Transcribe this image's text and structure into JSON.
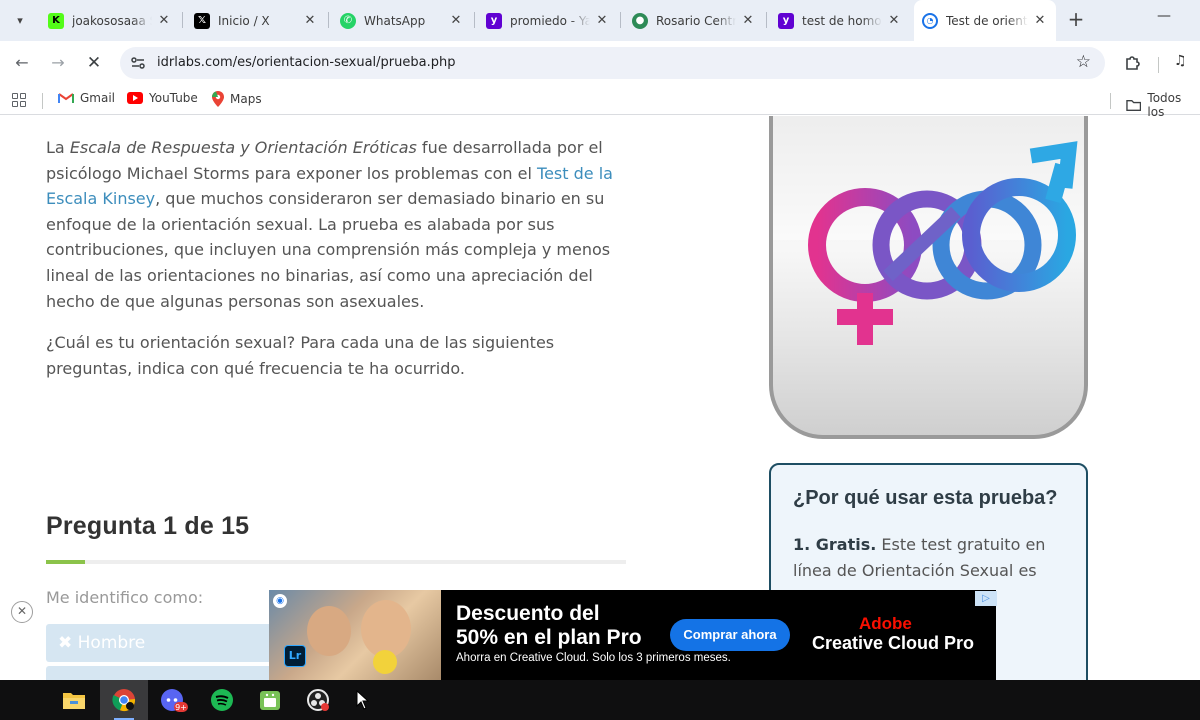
{
  "tabs": [
    {
      "title": "joakososaaa S",
      "favicon": "kick-icon",
      "color": "#53fc18",
      "active": false
    },
    {
      "title": "Inicio / X",
      "favicon": "x-icon",
      "color": "#000000",
      "active": false
    },
    {
      "title": "WhatsApp",
      "favicon": "whatsapp-icon",
      "color": "#25d366",
      "active": false
    },
    {
      "title": "promiedo - Ya",
      "favicon": "yahoo-icon",
      "color": "#6001d2",
      "active": false
    },
    {
      "title": "Rosario Centr",
      "favicon": "soccer-ball-icon",
      "color": "#2e8b57",
      "active": false
    },
    {
      "title": "test de homo",
      "favicon": "yahoo-icon",
      "color": "#6001d2",
      "active": false
    },
    {
      "title": "Test de orient",
      "favicon": "loading-icon",
      "color": "#1a73e8",
      "active": true
    }
  ],
  "address_bar": {
    "url": "idrlabs.com/es/orientacion-sexual/prueba.php"
  },
  "bookmarks": {
    "items": [
      {
        "label": "Gmail",
        "icon": "gmail-icon"
      },
      {
        "label": "YouTube",
        "icon": "youtube-icon"
      },
      {
        "label": "Maps",
        "icon": "maps-icon"
      }
    ],
    "all_bookmarks": "Todos los"
  },
  "article": {
    "p1_a": "La ",
    "p1_em": "Escala de Respuesta y Orientación Eróticas",
    "p1_b": " fue desarrollada por el psicólogo Michael Storms para exponer los problemas con el ",
    "p1_link": "Test de la Escala Kinsey",
    "p1_c": ", que muchos consideraron ser demasiado binario en su enfoque de la orientación sexual. La prueba es alabada por sus contribuciones, que incluyen una comprensión más compleja y menos lineal de las orientaciones no binarias, así como una apreciación del hecho de que algunas personas son asexuales.",
    "p2": "¿Cuál es tu orientación sexual? Para cada una de las siguientes preguntas, indica con qué frecuencia te ha ocurrido."
  },
  "question": {
    "title": "Pregunta 1 de 15",
    "progress": 0.0667,
    "prompt": "Me identifico como:",
    "answers": [
      "✖ Hombre"
    ]
  },
  "sidebar": {
    "why_title": "¿Por qué usar esta prueba?",
    "why_item_num": "1. Gratis.",
    "why_item_text": " Este test gratuito en línea de Orientación Sexual es"
  },
  "ad": {
    "headline_1": "Descuento del",
    "headline_2": "50% en el plan Pro",
    "subtext": "Ahorra en Creative Cloud. Solo los 3 primeros meses.",
    "cta": "Comprar ahora",
    "brand_1": "Adobe",
    "brand_2": "Creative Cloud Pro",
    "app_badge": "Lr"
  },
  "taskbar": {
    "apps": [
      {
        "name": "file-explorer-icon",
        "color": "#f4c542"
      },
      {
        "name": "chrome-icon",
        "color": "#4285f4",
        "active": true
      },
      {
        "name": "discord-icon",
        "color": "#5865f2",
        "badge": "9+"
      },
      {
        "name": "spotify-icon",
        "color": "#1db954"
      },
      {
        "name": "android-icon",
        "color": "#78c257"
      },
      {
        "name": "obs-icon",
        "color": "#e8e8e8"
      }
    ]
  }
}
